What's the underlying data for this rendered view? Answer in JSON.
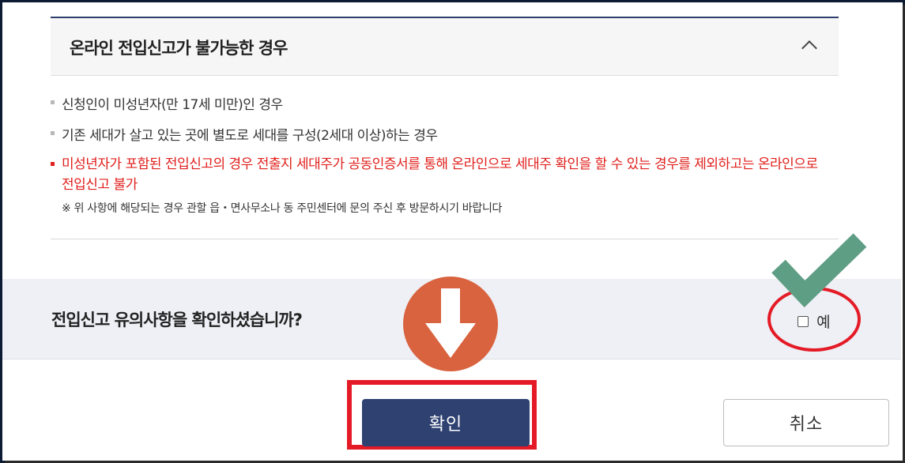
{
  "section": {
    "title": "온라인 전입신고가 불가능한 경우"
  },
  "conditions": [
    "신청인이 미성년자(만 17세 미만)인 경우",
    "기존 세대가 살고 있는 곳에 별도로 세대를 구성(2세대 이상)하는 경우",
    "미성년자가 포함된 전입신고의 경우 전출지 세대주가 공동인증서를 통해 온라인으로 세대주 확인을 할 수 있는 경우를 제외하고는 온라인으로 전입신고 불가"
  ],
  "note": "※ 위 사항에 해당되는 경우 관할 읍・면사무소나 동 주민센터에 문의 주신 후 방문하시기 바랍니다",
  "confirm": {
    "question": "전입신고 유의사항을 확인하셨습니까?",
    "checkbox_label": "예",
    "checked": false
  },
  "buttons": {
    "ok": "확인",
    "cancel": "취소"
  },
  "colors": {
    "accent_navy": "#2e4171",
    "warning_red": "#e0201c",
    "highlight_red": "#e41b26",
    "arrow_orange": "#d9623f",
    "check_green": "#5e9e84"
  }
}
